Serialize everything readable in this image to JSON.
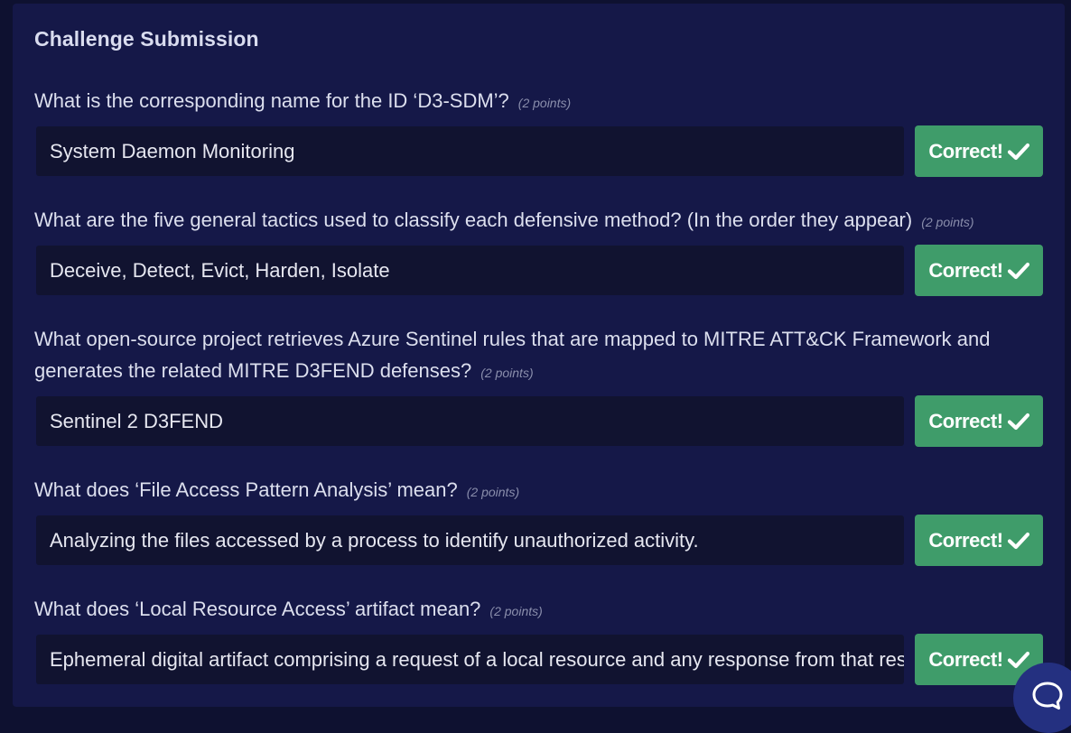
{
  "title": "Challenge Submission",
  "questions": [
    {
      "text": "What is the corresponding name for the ID ‘D3-SDM’?",
      "points": "(2 points)",
      "answer": "System Daemon Monitoring",
      "button": "Correct!"
    },
    {
      "text": "What are the five general tactics used to classify each defensive method? (In the order they appear)",
      "points": "(2 points)",
      "answer": "Deceive, Detect, Evict, Harden, Isolate",
      "button": "Correct!"
    },
    {
      "text": "What open-source project retrieves Azure Sentinel rules that are mapped to MITRE ATT&CK Framework and generates the related MITRE D3FEND defenses?",
      "points": "(2 points)",
      "answer": "Sentinel 2 D3FEND",
      "button": "Correct!"
    },
    {
      "text": "What does ‘File Access Pattern Analysis’ mean?",
      "points": "(2 points)",
      "answer": "Analyzing the files accessed by a process to identify unauthorized activity.",
      "button": "Correct!"
    },
    {
      "text": "What does ‘Local Resource Access’ artifact mean?",
      "points": "(2 points)",
      "answer": "Ephemeral digital artifact comprising a request of a local resource and any response from that resource.",
      "button": "Correct!"
    }
  ],
  "icons": {
    "correct": "check-icon",
    "chat": "chat-bubble-icon"
  },
  "colors": {
    "background": "#0e1130",
    "panel": "#151848",
    "answer_field": "#111330",
    "correct_button": "#3f9c6a",
    "chat_button": "#243080"
  }
}
